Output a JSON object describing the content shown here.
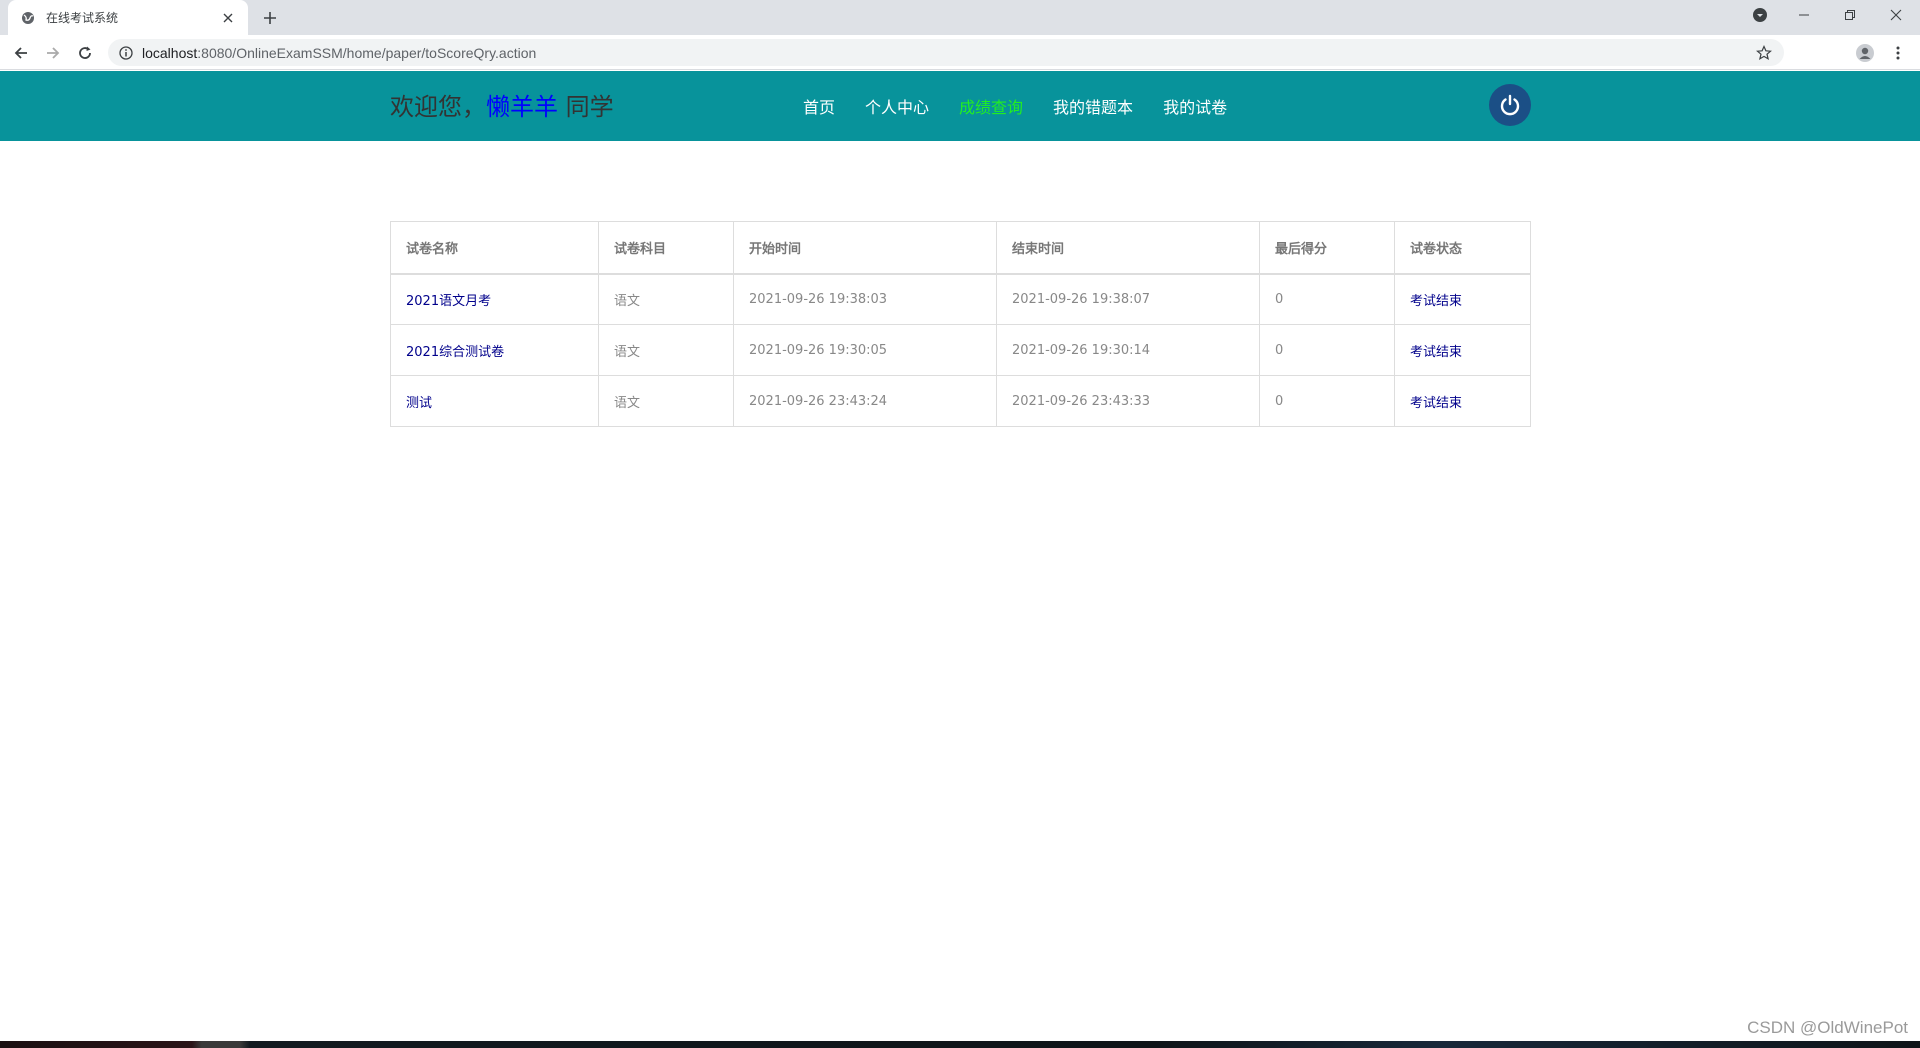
{
  "browser": {
    "tab_title": "在线考试系统",
    "url_host": "localhost",
    "url_path": ":8080/OnlineExamSSM/home/paper/toScoreQry.action"
  },
  "header": {
    "welcome_prefix": "欢迎您，",
    "username": "懒羊羊",
    "welcome_suffix": " 同学",
    "nav": [
      {
        "label": "首页"
      },
      {
        "label": "个人中心"
      },
      {
        "label": "成绩查询",
        "active": true
      },
      {
        "label": "我的错题本"
      },
      {
        "label": "我的试卷"
      }
    ],
    "active_color": "#22ee22",
    "bg_color": "#08939b"
  },
  "table": {
    "columns": [
      "试卷名称",
      "试卷科目",
      "开始时间",
      "结束时间",
      "最后得分",
      "试卷状态"
    ],
    "rows": [
      {
        "name": "2021语文月考",
        "subject": "语文",
        "start": "2021-09-26 19:38:03",
        "end": "2021-09-26 19:38:07",
        "score": "0",
        "status": "考试结束"
      },
      {
        "name": "2021综合测试卷",
        "subject": "语文",
        "start": "2021-09-26 19:30:05",
        "end": "2021-09-26 19:30:14",
        "score": "0",
        "status": "考试结束"
      },
      {
        "name": "测试",
        "subject": "语文",
        "start": "2021-09-26 23:43:24",
        "end": "2021-09-26 23:43:33",
        "score": "0",
        "status": "考试结束"
      }
    ]
  },
  "watermark": "CSDN @OldWinePot"
}
